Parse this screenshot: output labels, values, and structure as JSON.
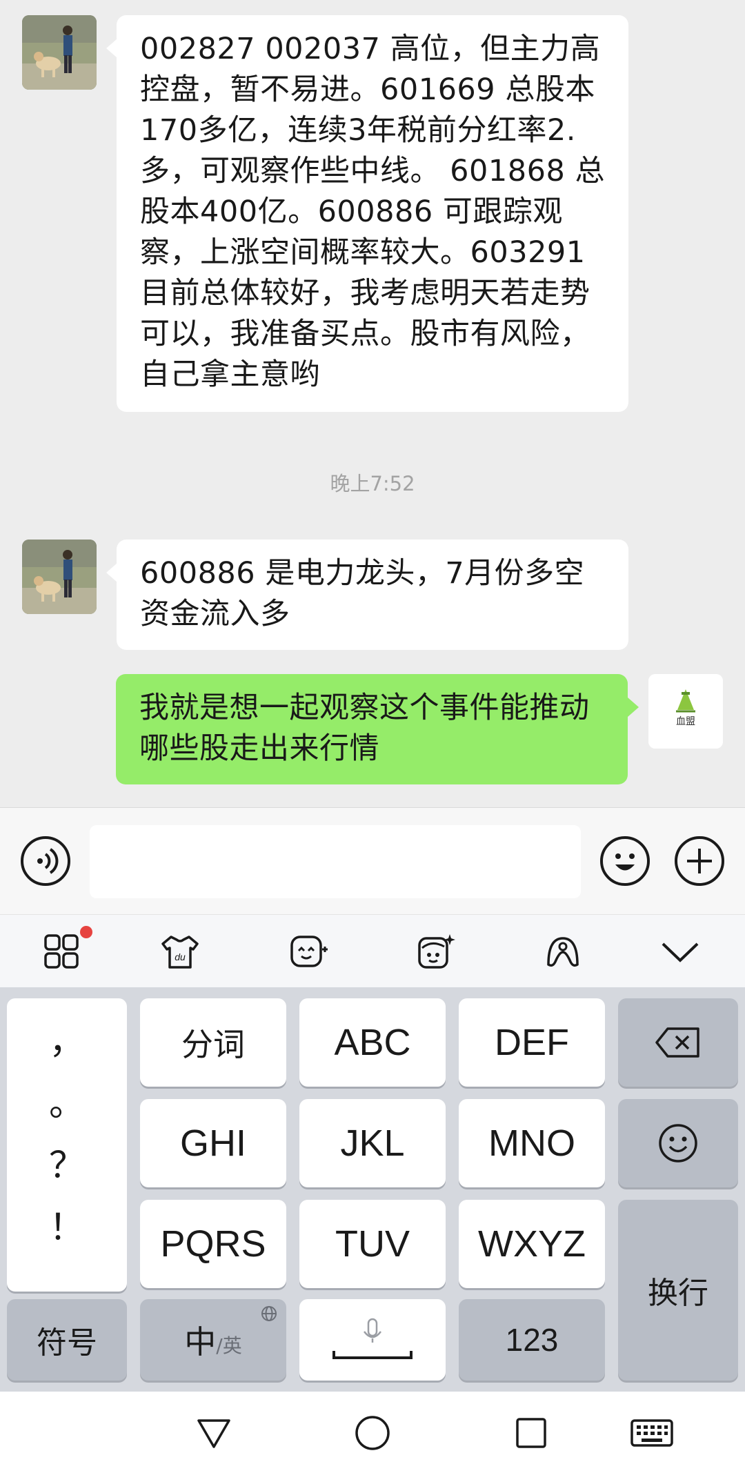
{
  "chat": {
    "messages": [
      {
        "from": "other",
        "text": "002827  002037 高位，但主力高控盘，暂不易进。601669 总股本170多亿，连续3年税前分红率2.多，可观察作些中线。 601868 总股本400亿。600886 可跟踪观察，上涨空间概率较大。603291 目前总体较好，我考虑明天若走势可以，我准备买点。股市有风险，自己拿主意哟"
      },
      {
        "from": "time",
        "text": "晚上7:52"
      },
      {
        "from": "other",
        "text": "600886 是电力龙头，7月份多空资金流入多"
      },
      {
        "from": "me",
        "text": "我就是想一起观察这个事件能推动哪些股走出来行情"
      }
    ],
    "my_avatar_text": "血盟"
  },
  "input": {
    "voice_icon": "voice-icon",
    "emoji_icon": "emoji-icon",
    "plus_icon": "plus-icon",
    "value": ""
  },
  "ime_toolbar": {
    "icons": [
      "apps-grid-icon",
      "skin-icon",
      "kaomoji-icon",
      "sticker-icon",
      "handwriting-icon",
      "collapse-icon"
    ],
    "badge_color": "#e64340"
  },
  "keyboard": {
    "punct": [
      "，",
      "。",
      "？",
      "！"
    ],
    "row1": [
      "分词",
      "ABC",
      "DEF"
    ],
    "row2": [
      "GHI",
      "JKL",
      "MNO"
    ],
    "row3": [
      "PQRS",
      "TUV",
      "WXYZ"
    ],
    "symbol": "符号",
    "lang_main": "中",
    "lang_alt": "/英",
    "num": "123",
    "enter": "换行"
  },
  "colors": {
    "chat_bg": "#ededed",
    "my_bubble": "#95ec69",
    "other_bubble": "#ffffff"
  }
}
